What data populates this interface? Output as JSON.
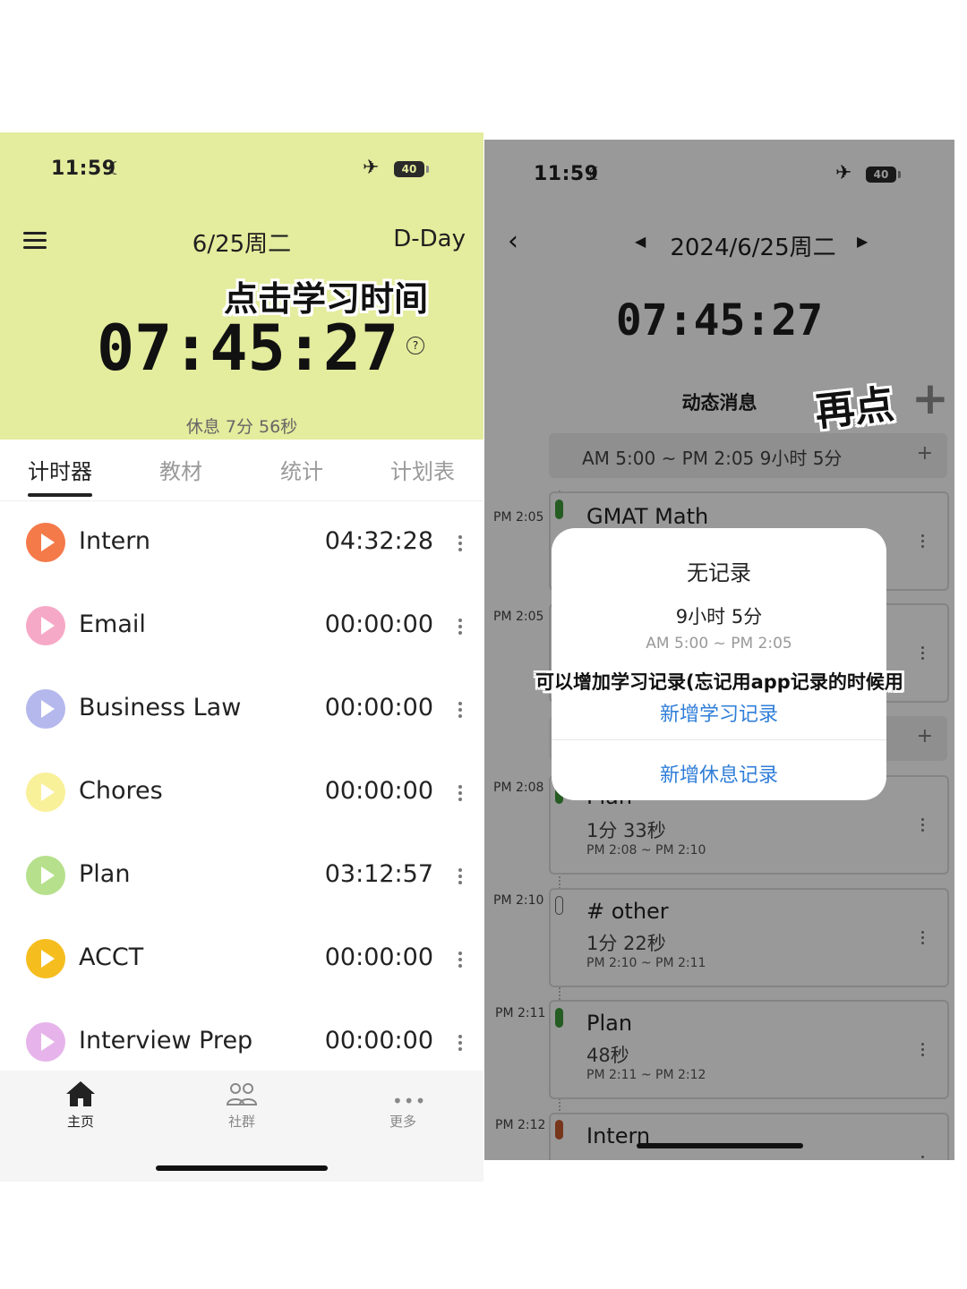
{
  "left": {
    "status": {
      "time": "11:59",
      "battery": "40"
    },
    "header": {
      "date": "6/25周二",
      "dday": "D-Day"
    },
    "annotation": "点击学习时间",
    "timer": "07:45:27",
    "rest": "休息  7分 56秒",
    "tabs": [
      "计时器",
      "教材",
      "统计",
      "计划表"
    ],
    "subjects": [
      {
        "name": "Intern",
        "time": "04:32:28",
        "color": "#f47a4a"
      },
      {
        "name": "Email",
        "time": "00:00:00",
        "color": "#f6a9c6"
      },
      {
        "name": "Business Law",
        "time": "00:00:00",
        "color": "#b4b8ec"
      },
      {
        "name": "Chores",
        "time": "00:00:00",
        "color": "#f9f09a"
      },
      {
        "name": "Plan",
        "time": "03:12:57",
        "color": "#b6e08c"
      },
      {
        "name": "ACCT",
        "time": "00:00:00",
        "color": "#f6bd1f"
      },
      {
        "name": "Interview Prep",
        "time": "00:00:00",
        "color": "#e6b4ea"
      }
    ],
    "nav": [
      {
        "label": "主页",
        "icon": "home-icon"
      },
      {
        "label": "社群",
        "icon": "community-icon"
      },
      {
        "label": "更多",
        "icon": "more-icon"
      }
    ]
  },
  "right": {
    "status": {
      "time": "11:59",
      "battery": "40"
    },
    "header": {
      "date": "2024/6/25周二"
    },
    "timer": "07:45:27",
    "feed_label": "动态消息",
    "annotation": "再点",
    "range_bar": "AM 5:00 ~ PM 2:05  9小时 5分",
    "timeline": [
      {
        "time": "PM 2:05",
        "title": "GMAT Math",
        "duration": "",
        "range": "",
        "pill": "#3c9a3a"
      },
      {
        "time": "PM 2:05",
        "title": "",
        "duration": "",
        "range": "",
        "pill": ""
      },
      {
        "time": "PM 2:08",
        "title": "Plan",
        "duration": "1分 33秒",
        "range": "PM 2:08 ~ PM 2:10",
        "pill": "#3c9a3a"
      },
      {
        "time": "PM 2:10",
        "title": "# other",
        "duration": "1分 22秒",
        "range": "PM 2:10 ~ PM 2:11",
        "pill": "outline"
      },
      {
        "time": "PM 2:11",
        "title": "Plan",
        "duration": "48秒",
        "range": "PM 2:11 ~ PM 2:12",
        "pill": "#3c9a3a"
      },
      {
        "time": "PM 2:12",
        "title": "Intern",
        "duration": "",
        "range": "",
        "pill": "#c65a2e"
      }
    ],
    "modal": {
      "title": "无记录",
      "duration": "9小时 5分",
      "range": "AM 5:00 ~ PM 2:05",
      "annotation": "可以增加学习记录(忘记用app记录的时候用",
      "add_study": "新增学习记录",
      "add_rest": "新增休息记录"
    }
  }
}
